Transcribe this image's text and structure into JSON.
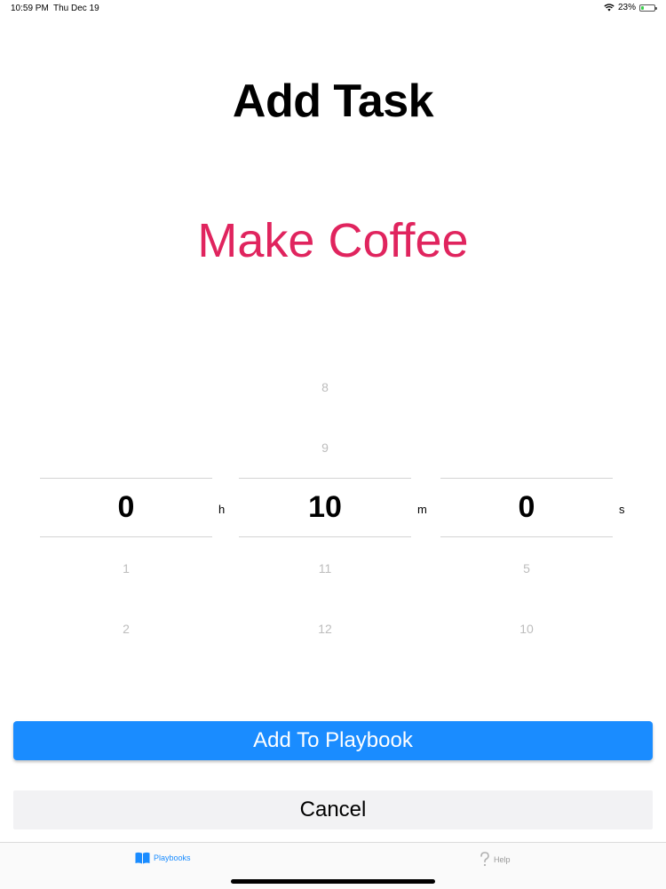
{
  "status_bar": {
    "time": "10:59 PM",
    "date": "Thu Dec 19",
    "battery_percent": "23%",
    "battery_level": 0.23
  },
  "title": "Add Task",
  "task_name": "Make Coffee",
  "colors": {
    "accent": "#1a8cff",
    "task_name": "#e0245e"
  },
  "picker": {
    "hours": {
      "above": [
        "",
        ""
      ],
      "selected": "0",
      "below": [
        "1",
        "2"
      ],
      "unit": "h"
    },
    "minutes": {
      "above": [
        "8",
        "9"
      ],
      "selected": "10",
      "below": [
        "11",
        "12"
      ],
      "unit": "m"
    },
    "seconds": {
      "above": [
        "",
        ""
      ],
      "selected": "0",
      "below": [
        "5",
        "10"
      ],
      "unit": "s"
    }
  },
  "buttons": {
    "add_label": "Add To Playbook",
    "cancel_label": "Cancel"
  },
  "tab_bar": {
    "tabs": [
      {
        "label": "Playbooks",
        "icon": "book-icon",
        "active": true
      },
      {
        "label": "Help",
        "icon": "question-icon",
        "active": false
      }
    ]
  }
}
